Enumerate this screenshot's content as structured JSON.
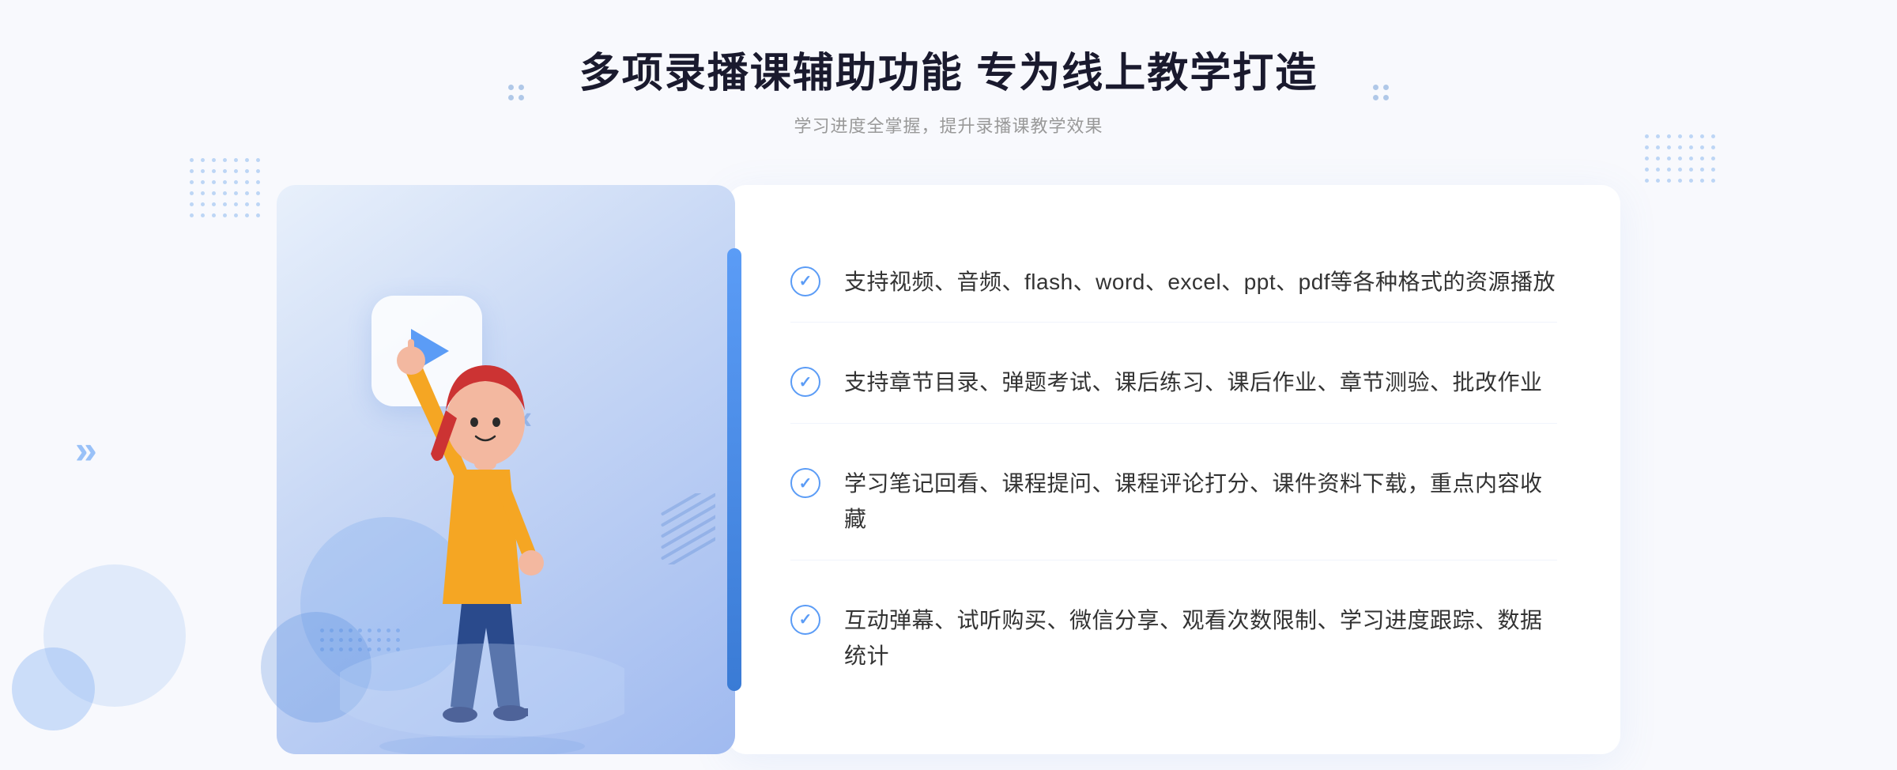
{
  "page": {
    "background": "#f7f9fd"
  },
  "header": {
    "main_title": "多项录播课辅助功能 专为线上教学打造",
    "sub_title": "学习进度全掌握，提升录播课教学效果"
  },
  "features": [
    {
      "id": 1,
      "text": "支持视频、音频、flash、word、excel、ppt、pdf等各种格式的资源播放"
    },
    {
      "id": 2,
      "text": "支持章节目录、弹题考试、课后练习、课后作业、章节测验、批改作业"
    },
    {
      "id": 3,
      "text": "学习笔记回看、课程提问、课程评论打分、课件资料下载，重点内容收藏"
    },
    {
      "id": 4,
      "text": "互动弹幕、试听购买、微信分享、观看次数限制、学习进度跟踪、数据统计"
    }
  ],
  "icons": {
    "play": "▶",
    "check": "✓",
    "chevron_left": "»",
    "dot_icon": "·"
  }
}
